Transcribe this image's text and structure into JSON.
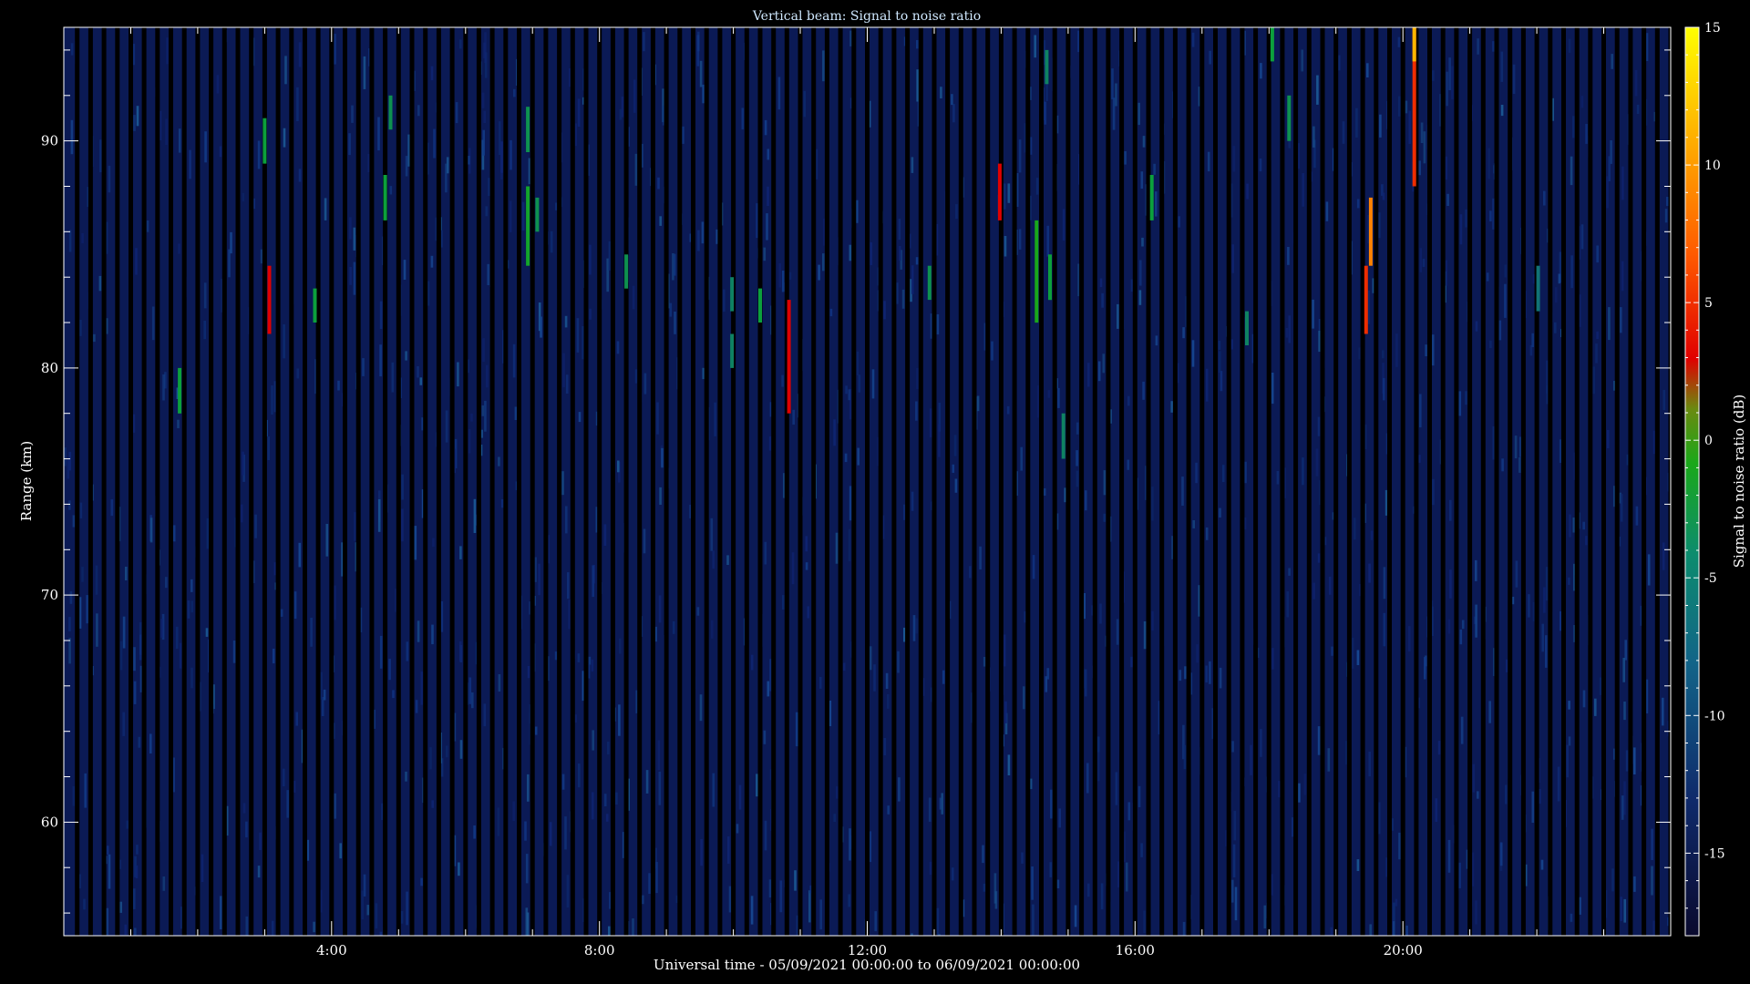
{
  "chart_data": {
    "type": "heatmap",
    "title": "Vertical beam: Signal to noise ratio",
    "xlabel": "Universal time - 05/09/2021 00:00:00 to 06/09/2021 00:00:00",
    "ylabel": "Range (km)",
    "colorbar_label": "Signal to noise ratio (dB)",
    "x_unit": "hours UT",
    "xlim": [
      0,
      24
    ],
    "ylim": [
      55,
      95
    ],
    "clim": [
      -18,
      15
    ],
    "x_ticks": [
      {
        "value": 4,
        "label": "4:00"
      },
      {
        "value": 8,
        "label": "8:00"
      },
      {
        "value": 12,
        "label": "12:00"
      },
      {
        "value": 16,
        "label": "16:00"
      },
      {
        "value": 20,
        "label": "20:00"
      }
    ],
    "y_ticks": [
      {
        "value": 60,
        "label": "60"
      },
      {
        "value": 70,
        "label": "70"
      },
      {
        "value": 80,
        "label": "80"
      },
      {
        "value": 90,
        "label": "90"
      }
    ],
    "colorbar_ticks": [
      {
        "value": 15,
        "label": "15"
      },
      {
        "value": 10,
        "label": "10"
      },
      {
        "value": 5,
        "label": "5"
      },
      {
        "value": 0,
        "label": "0"
      },
      {
        "value": -5,
        "label": "-5"
      },
      {
        "value": -10,
        "label": "-10"
      },
      {
        "value": -15,
        "label": "-15"
      }
    ],
    "background_snr": -15,
    "data_gap_interval_hours": 0.2,
    "echoes": [
      {
        "time": 1.73,
        "range_start": 78.0,
        "range_end": 80.0,
        "snr": -5
      },
      {
        "time": 3.0,
        "range_start": 89.0,
        "range_end": 91.0,
        "snr": -5
      },
      {
        "time": 3.07,
        "range_start": 81.5,
        "range_end": 84.5,
        "snr": 0
      },
      {
        "time": 3.75,
        "range_start": 82.0,
        "range_end": 83.5,
        "snr": -5
      },
      {
        "time": 4.8,
        "range_start": 86.5,
        "range_end": 88.5,
        "snr": -5
      },
      {
        "time": 4.88,
        "range_start": 90.5,
        "range_end": 92.0,
        "snr": -6
      },
      {
        "time": 6.93,
        "range_start": 84.5,
        "range_end": 88.0,
        "snr": -4
      },
      {
        "time": 6.93,
        "range_start": 89.5,
        "range_end": 91.5,
        "snr": -6
      },
      {
        "time": 7.07,
        "range_start": 86.0,
        "range_end": 87.5,
        "snr": -6
      },
      {
        "time": 8.4,
        "range_start": 83.5,
        "range_end": 85.0,
        "snr": -6
      },
      {
        "time": 9.98,
        "range_start": 82.5,
        "range_end": 84.0,
        "snr": -7
      },
      {
        "time": 9.98,
        "range_start": 80.0,
        "range_end": 81.5,
        "snr": -7
      },
      {
        "time": 10.4,
        "range_start": 82.0,
        "range_end": 83.5,
        "snr": -5
      },
      {
        "time": 10.83,
        "range_start": 78.0,
        "range_end": 83.0,
        "snr": 0
      },
      {
        "time": 12.93,
        "range_start": 83.0,
        "range_end": 84.5,
        "snr": -6
      },
      {
        "time": 13.98,
        "range_start": 86.5,
        "range_end": 89.0,
        "snr": 0
      },
      {
        "time": 14.53,
        "range_start": 82.0,
        "range_end": 86.5,
        "snr": -3
      },
      {
        "time": 14.73,
        "range_start": 83.0,
        "range_end": 85.0,
        "snr": -5
      },
      {
        "time": 14.93,
        "range_start": 76.0,
        "range_end": 78.0,
        "snr": -7
      },
      {
        "time": 14.68,
        "range_start": 92.5,
        "range_end": 94.0,
        "snr": -7
      },
      {
        "time": 16.25,
        "range_start": 86.5,
        "range_end": 88.5,
        "snr": -5
      },
      {
        "time": 17.67,
        "range_start": 81.0,
        "range_end": 82.5,
        "snr": -7
      },
      {
        "time": 18.05,
        "range_start": 93.5,
        "range_end": 95.0,
        "snr": -5
      },
      {
        "time": 18.3,
        "range_start": 90.0,
        "range_end": 92.0,
        "snr": -6
      },
      {
        "time": 19.45,
        "range_start": 81.5,
        "range_end": 84.5,
        "snr": 2
      },
      {
        "time": 19.52,
        "range_start": 84.5,
        "range_end": 87.5,
        "snr": 6
      },
      {
        "time": 20.17,
        "range_start": 88.0,
        "range_end": 95.0,
        "snr": 2
      },
      {
        "time": 20.17,
        "range_start": 93.5,
        "range_end": 95.0,
        "snr": 9
      },
      {
        "time": 22.02,
        "range_start": 82.5,
        "range_end": 84.5,
        "snr": -8
      }
    ]
  }
}
